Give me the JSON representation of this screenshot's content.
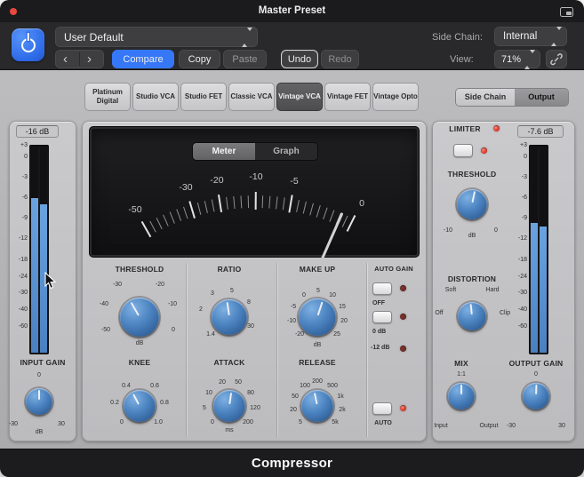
{
  "titlebar": {
    "title": "Master Preset"
  },
  "header": {
    "preset": "User Default",
    "side_chain_label": "Side Chain:",
    "side_chain_value": "Internal",
    "back": "‹",
    "forward": "›",
    "compare": "Compare",
    "copy": "Copy",
    "paste": "Paste",
    "undo": "Undo",
    "redo": "Redo",
    "view_label": "View:",
    "view_value": "71%"
  },
  "tabs": {
    "items": [
      "Platinum Digital",
      "Studio VCA",
      "Studio FET",
      "Classic VCA",
      "Vintage VCA",
      "Vintage FET",
      "Vintage Opto"
    ],
    "active": "Vintage VCA"
  },
  "sidechain_toggle": {
    "left": "Side Chain",
    "right": "Output"
  },
  "display": {
    "meter": "Meter",
    "graph": "Graph",
    "scale": [
      "-50",
      "-30",
      "-20",
      "-10",
      "-5",
      "0"
    ]
  },
  "meter_scale": [
    "+3",
    "0",
    "-3",
    "-6",
    "-9",
    "-12",
    "-18",
    "-24",
    "-30",
    "-40",
    "-60"
  ],
  "input_meter": {
    "readout": "-16 dB",
    "levels": [
      75,
      72
    ]
  },
  "output_meter": {
    "readout": "-7.6 dB",
    "levels": [
      63,
      61
    ]
  },
  "input_gain": {
    "label": "INPUT GAIN",
    "top": "0",
    "min": "-30",
    "max": "30",
    "unit": "dB",
    "angle": 0
  },
  "output_gain": {
    "label": "OUTPUT GAIN",
    "top": "0",
    "min": "-30",
    "max": "30",
    "angle": 2
  },
  "comp": {
    "threshold": {
      "label": "THRESHOLD",
      "s": [
        "-30",
        "-20",
        "-40",
        "-10",
        "-50",
        "0"
      ],
      "unit": "dB",
      "angle": -30
    },
    "ratio": {
      "label": "RATIO",
      "s": [
        "1.4",
        "2",
        "3",
        "5",
        "8",
        "30"
      ],
      "angle": -8
    },
    "makeup": {
      "label": "MAKE UP",
      "s": [
        "-20",
        "-10",
        "-5",
        "0",
        "5",
        "10",
        "15",
        "20",
        "25"
      ],
      "unit": "dB",
      "angle": 18
    },
    "knee": {
      "label": "KNEE",
      "s": [
        "0",
        "0.2",
        "0.4",
        "0.6",
        "0.8",
        "1.0"
      ],
      "angle": -28
    },
    "attack": {
      "label": "ATTACK",
      "s": [
        "0",
        "5",
        "10",
        "20",
        "50",
        "80",
        "120",
        "200"
      ],
      "unit": "ms",
      "angle": 8
    },
    "release": {
      "label": "RELEASE",
      "s": [
        "5",
        "20",
        "50",
        "100",
        "200",
        "500",
        "1k",
        "2k",
        "5k"
      ],
      "unit": "ms",
      "auto": "AUTO",
      "angle": -12
    },
    "auto_gain": {
      "label": "AUTO GAIN",
      "options": [
        "OFF",
        "0 dB",
        "-12 dB"
      ]
    }
  },
  "limiter": {
    "label": "LIMITER",
    "threshold_label": "THRESHOLD",
    "s": [
      "-10",
      "0"
    ],
    "unit": "dB",
    "angle": 12
  },
  "distortion": {
    "label": "DISTORTION",
    "s": [
      "Soft",
      "Hard",
      "Off",
      "Clip"
    ],
    "angle": -6
  },
  "mix": {
    "label": "MIX",
    "top": "1:1",
    "min": "Input",
    "max": "Output",
    "angle": 0
  },
  "footer": {
    "name": "Compressor"
  }
}
